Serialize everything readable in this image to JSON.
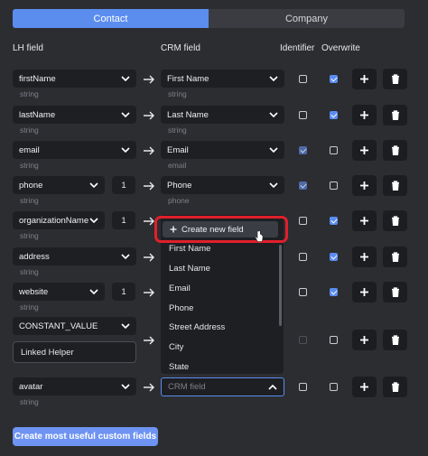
{
  "tabs": [
    {
      "label": "Contact",
      "active": true
    },
    {
      "label": "Company",
      "active": false
    }
  ],
  "headers": {
    "lh": "LH field",
    "crm": "CRM field",
    "identifier": "Identifier",
    "overwrite": "Overwrite"
  },
  "rows": [
    {
      "lh": "firstName",
      "type": "string",
      "crm": "First Name",
      "crm_sub": "string",
      "identifier": "unchecked",
      "overwrite": "checked"
    },
    {
      "lh": "lastName",
      "type": "string",
      "crm": "Last Name",
      "crm_sub": "string",
      "identifier": "unchecked",
      "overwrite": "checked"
    },
    {
      "lh": "email",
      "type": "string",
      "crm": "Email",
      "crm_sub": "email",
      "identifier": "dim-checked",
      "overwrite": "unchecked"
    },
    {
      "lh": "phone",
      "type": "string",
      "index": "1",
      "crm": "Phone",
      "crm_sub": "phone",
      "identifier": "dim-checked",
      "overwrite": "unchecked"
    },
    {
      "lh": "organizationName",
      "type": "string",
      "index": "1",
      "identifier": "unchecked",
      "overwrite": "checked"
    },
    {
      "lh": "address",
      "type": "string",
      "identifier": "unchecked",
      "overwrite": "checked"
    },
    {
      "lh": "website",
      "type": "string",
      "index": "1",
      "identifier": "unchecked",
      "overwrite": "checked"
    },
    {
      "lh": "CONSTANT_VALUE",
      "constant_value": "Linked Helper",
      "identifier": "dim",
      "overwrite": "unchecked"
    },
    {
      "lh": "avatar",
      "type": "string",
      "crm_placeholder": "CRM field",
      "identifier": "unchecked",
      "overwrite": "unchecked"
    }
  ],
  "dropdown": {
    "create_label": "Create new field",
    "options": [
      "First Name",
      "Last Name",
      "Email",
      "Phone",
      "Street Address",
      "City",
      "State"
    ]
  },
  "cta_label": "Create most useful custom fields",
  "colors": {
    "accent": "#5b8def",
    "highlight": "#e0202a",
    "background": "#2b2d31"
  },
  "icons": [
    "chevron-down-icon",
    "chevron-up-icon",
    "arrow-right-icon",
    "plus-icon",
    "trash-icon",
    "cursor-icon"
  ]
}
